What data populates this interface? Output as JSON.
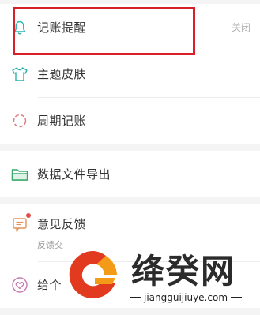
{
  "settings": {
    "reminder": {
      "label": "记账提醒",
      "value": "关闭",
      "icon": "bell-icon"
    },
    "theme": {
      "label": "主题皮肤",
      "icon": "shirt-icon"
    },
    "periodic": {
      "label": "周期记账",
      "icon": "cycle-icon"
    },
    "export": {
      "label": "数据文件导出",
      "icon": "folder-icon"
    },
    "feedback": {
      "label": "意见反馈",
      "sub": "反馈交",
      "icon": "message-icon"
    },
    "rate": {
      "label": "给个",
      "icon": "heart-icon"
    }
  },
  "watermark": {
    "title": "绛癸网",
    "url": "jiangguijiuye.com"
  },
  "colors": {
    "highlight": "#d9202a",
    "icon_teal": "#2bb3b0",
    "icon_green": "#3aa86b",
    "icon_pink": "#e07aa0",
    "logo_red": "#e23a1e",
    "logo_orange": "#f39a16"
  }
}
